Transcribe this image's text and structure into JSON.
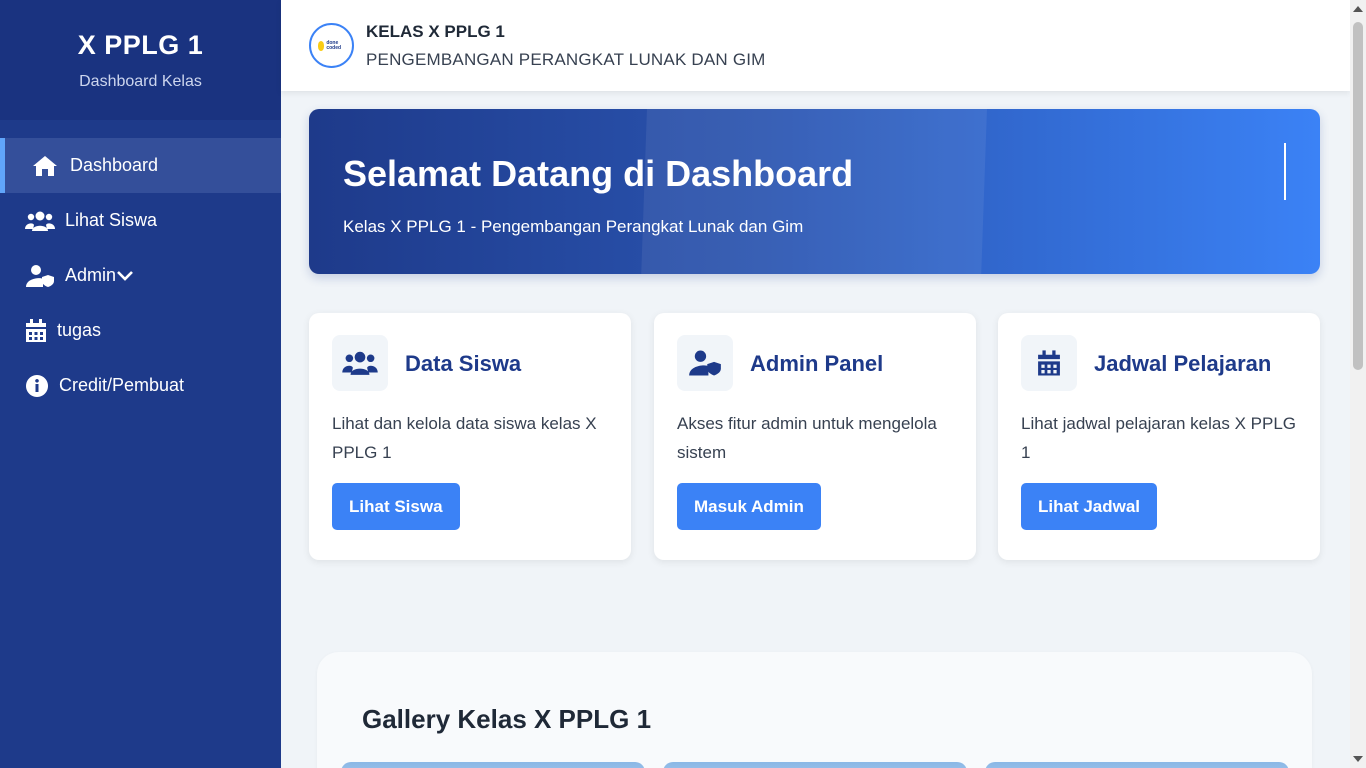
{
  "sidebar": {
    "brand": "X PPLG 1",
    "subtitle": "Dashboard Kelas",
    "items": [
      {
        "label": "Dashboard",
        "icon": "home-icon"
      },
      {
        "label": "Lihat Siswa",
        "icon": "users-icon"
      },
      {
        "label": "Admin",
        "icon": "user-shield-icon"
      },
      {
        "label": "tugas",
        "icon": "calendar-icon"
      },
      {
        "label": "Credit/Pembuat",
        "icon": "info-icon"
      }
    ]
  },
  "header": {
    "title": "KELAS X PPLG 1",
    "subtitle": "PENGEMBANGAN PERANGKAT LUNAK DAN GIM",
    "logo_text": "done coded"
  },
  "hero": {
    "title": "Selamat Datang di Dashboard",
    "subtitle": "Kelas X PPLG 1 - Pengembangan Perangkat Lunak dan Gim"
  },
  "cards": [
    {
      "title": "Data Siswa",
      "desc": "Lihat dan kelola data siswa kelas X PPLG 1",
      "button": "Lihat Siswa",
      "icon": "users-icon"
    },
    {
      "title": "Admin Panel",
      "desc": "Akses fitur admin untuk mengelola sistem",
      "button": "Masuk Admin",
      "icon": "user-shield-icon"
    },
    {
      "title": "Jadwal Pelajaran",
      "desc": "Lihat jadwal pelajaran kelas X PPLG 1",
      "button": "Lihat Jadwal",
      "icon": "calendar-icon"
    }
  ],
  "gallery": {
    "title": "Gallery Kelas X PPLG 1"
  },
  "colors": {
    "sidebar": "#1e3a8a",
    "accent": "#3b82f6",
    "background": "#f0f4f8"
  }
}
